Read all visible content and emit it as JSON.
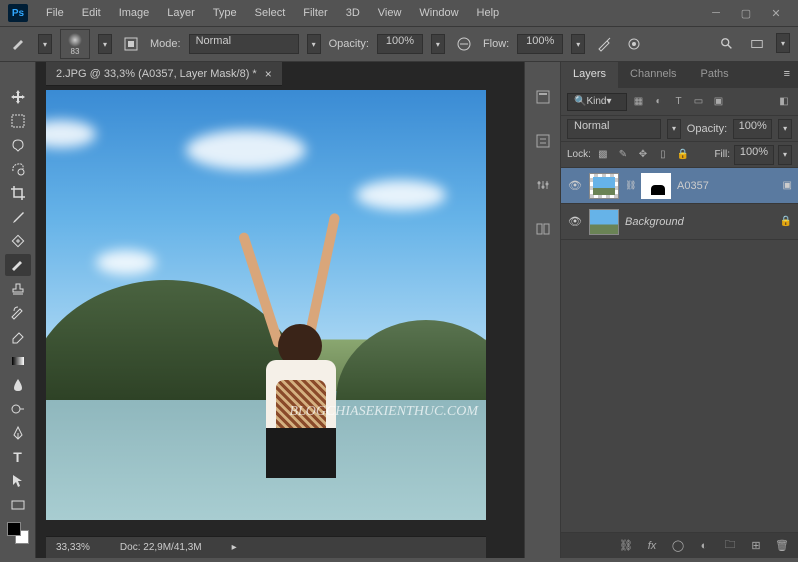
{
  "menu": [
    "File",
    "Edit",
    "Image",
    "Layer",
    "Type",
    "Select",
    "Filter",
    "3D",
    "View",
    "Window",
    "Help"
  ],
  "options": {
    "brush_size": "83",
    "mode_label": "Mode:",
    "mode_value": "Normal",
    "opacity_label": "Opacity:",
    "opacity_value": "100%",
    "flow_label": "Flow:",
    "flow_value": "100%"
  },
  "document": {
    "tab": "2.JPG @ 33,3% (A0357, Layer Mask/8) *",
    "zoom": "33,33%",
    "doc_label": "Doc:",
    "doc_size": "22,9M/41,3M",
    "watermark": "BLOGCHIASEKIENTHUC.COM"
  },
  "layers_panel": {
    "tabs": [
      "Layers",
      "Channels",
      "Paths"
    ],
    "kind_label": "Kind",
    "blend_mode": "Normal",
    "opacity_label": "Opacity:",
    "opacity_value": "100%",
    "lock_label": "Lock:",
    "fill_label": "Fill:",
    "fill_value": "100%",
    "layers": [
      {
        "name": "A0357",
        "locked": false,
        "selected": true,
        "has_mask": true
      },
      {
        "name": "Background",
        "locked": true,
        "selected": false,
        "has_mask": false
      }
    ]
  }
}
